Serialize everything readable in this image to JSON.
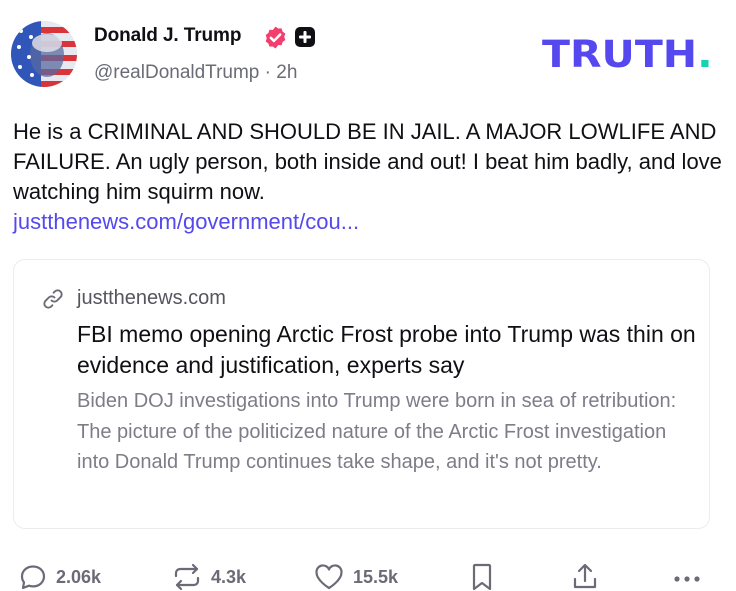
{
  "author": {
    "display_name": "Donald J. Trump",
    "handle": "@realDonaldTrump",
    "separator": "·",
    "time_ago": "2h"
  },
  "brand": {
    "logo_text": "TRUTH",
    "logo_dot": ".",
    "accent_color": "#5448ee",
    "dot_color": "#17d1b0",
    "verified_color": "#f23d6d"
  },
  "post": {
    "text": "He is a CRIMINAL AND SHOULD BE IN JAIL. A MAJOR LOWLIFE AND FAILURE. An ugly person, both inside and out! I beat him badly, and love watching him squirm now.",
    "link_text": "justthenews.com/government/cou..."
  },
  "link_card": {
    "domain": "justthenews.com",
    "title": "FBI memo opening Arctic Frost probe into Trump was thin on evidence and justification, experts say",
    "description": "Biden DOJ investigations into Trump were born in sea of retribution: The picture of the politicized nature of the Arctic Frost investigation into Donald Trump continues take shape, and it's not pretty.",
    "icon": "link-icon"
  },
  "actions": {
    "replies": "2.06k",
    "retruths": "4.3k",
    "likes": "15.5k",
    "icons": [
      "reply-icon",
      "retruth-icon",
      "like-icon",
      "bookmark-icon",
      "share-icon",
      "more-icon"
    ]
  }
}
